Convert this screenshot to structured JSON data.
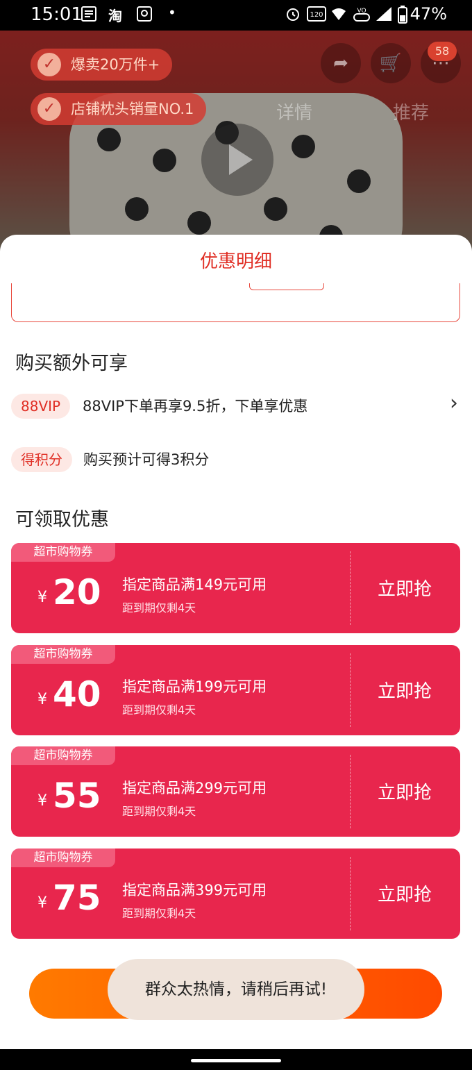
{
  "status_bar": {
    "time": "15:01",
    "battery_percent": "47%",
    "icons": [
      "notes-icon",
      "taobao-icon",
      "app-icon",
      "dot-icon",
      "alarm-icon",
      "120hz-icon",
      "wifi-icon",
      "volte-icon",
      "signal-icon",
      "battery-icon"
    ],
    "taobao_label": "淘"
  },
  "background": {
    "tags": [
      "爆卖20万件+",
      "店铺枕头销量NO.1"
    ],
    "cart_badge": "58",
    "nav_tabs": [
      "详情",
      "推荐"
    ]
  },
  "sheet": {
    "title": "优惠明细",
    "extra_section_title": "购买额外可享",
    "perks": [
      {
        "tag": "88VIP",
        "text": "88VIP下单再享9.5折，下单享优惠",
        "has_chevron": true
      },
      {
        "tag": "得积分",
        "text": "购买预计可得3积分",
        "has_chevron": false
      }
    ],
    "coupon_section_title": "可领取优惠",
    "coupons": [
      {
        "label": "超市购物券",
        "currency": "¥",
        "amount": "20",
        "condition": "指定商品满149元可用",
        "expiry": "距到期仅剩4天",
        "action": "立即抢"
      },
      {
        "label": "超市购物券",
        "currency": "¥",
        "amount": "40",
        "condition": "指定商品满199元可用",
        "expiry": "距到期仅剩4天",
        "action": "立即抢"
      },
      {
        "label": "超市购物券",
        "currency": "¥",
        "amount": "55",
        "condition": "指定商品满299元可用",
        "expiry": "距到期仅剩4天",
        "action": "立即抢"
      },
      {
        "label": "超市购物券",
        "currency": "¥",
        "amount": "75",
        "condition": "指定商品满399元可用",
        "expiry": "距到期仅剩4天",
        "action": "立即抢"
      }
    ],
    "bottom_button_label": "",
    "toast": "群众太热情，请稍后再试!"
  },
  "colors": {
    "accent_red": "#e02e24",
    "coupon_bg": "#e8264d",
    "coupon_label_bg": "#f25a7a",
    "button_orange": "#ff5a00",
    "toast_bg": "#efe3da"
  }
}
